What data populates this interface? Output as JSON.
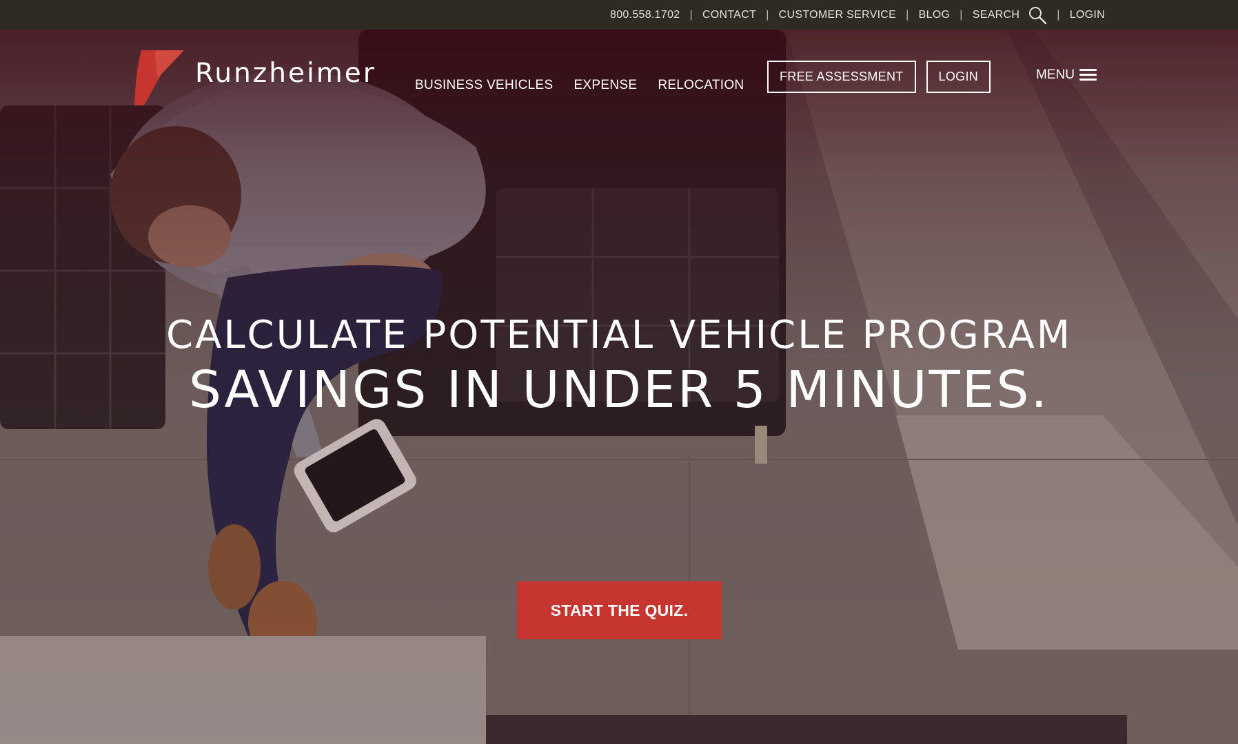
{
  "utility_nav": {
    "phone": "800.558.1702",
    "separator": "|",
    "contact": "CONTACT",
    "customer_service": "CUSTOMER SERVICE",
    "blog": "BLOG",
    "search": "SEARCH",
    "login": "LOGIN",
    "search_icon": "search-icon"
  },
  "brand": {
    "name": "Runzheimer",
    "logo_color": "#c6352f"
  },
  "main_nav": {
    "items": [
      {
        "label": "BUSINESS VEHICLES"
      },
      {
        "label": "EXPENSE"
      },
      {
        "label": "RELOCATION"
      }
    ],
    "free_assessment": "FREE ASSESSMENT",
    "login": "LOGIN",
    "menu": "MENU",
    "menu_icon": "hamburger-icon"
  },
  "hero": {
    "headline_line1": "CALCULATE POTENTIAL VEHICLE PROGRAM",
    "headline_line2": "SAVINGS IN UNDER 5 MINUTES.",
    "cta_label": "START THE QUIZ.",
    "cta_color": "#c6352f",
    "overlay_color": "#3e0814"
  },
  "colors": {
    "utility_bar": "#2f2b22",
    "accent": "#c6352f"
  }
}
